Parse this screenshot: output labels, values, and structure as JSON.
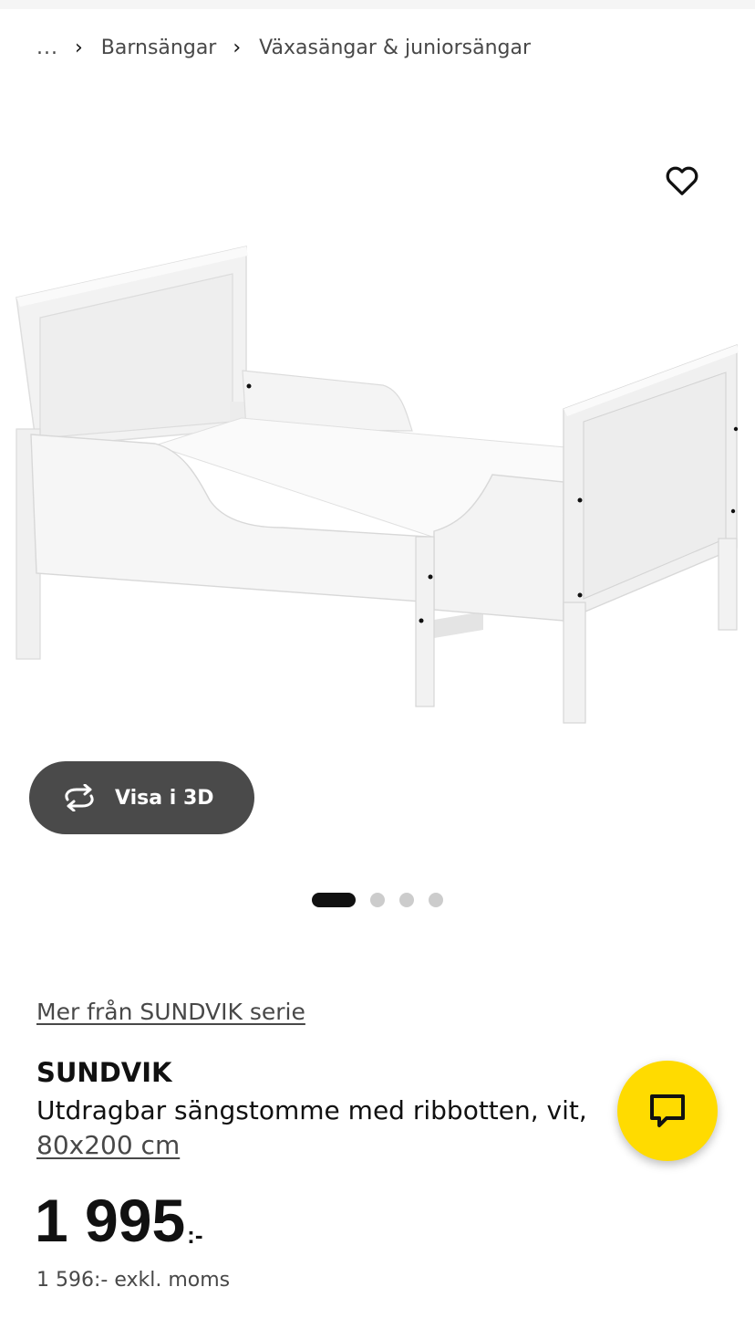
{
  "breadcrumb": {
    "ellipsis": "...",
    "separator": "›",
    "items": [
      "Barnsängar",
      "Växasängar & juniorsängar"
    ]
  },
  "icons": {
    "favorite": "heart-outline-icon",
    "view3d": "rotate-3d-icon",
    "chat": "chat-bubble-icon"
  },
  "gallery": {
    "view3d_label": "Visa i 3D",
    "total_images": 4,
    "active_index": 0
  },
  "product": {
    "series_link": "Mer från SUNDVIK serie",
    "name": "SUNDVIK",
    "description": "Utdragbar sängstomme med ribbotten, vit,",
    "size": "80x200 cm",
    "price": "1 995",
    "price_suffix": ":-",
    "price_excl_vat": "1 596:- exkl. moms"
  },
  "colors": {
    "accent_yellow": "#ffdb00",
    "button_dark": "#4a4a4a",
    "text_primary": "#111111",
    "text_secondary": "#484848"
  }
}
